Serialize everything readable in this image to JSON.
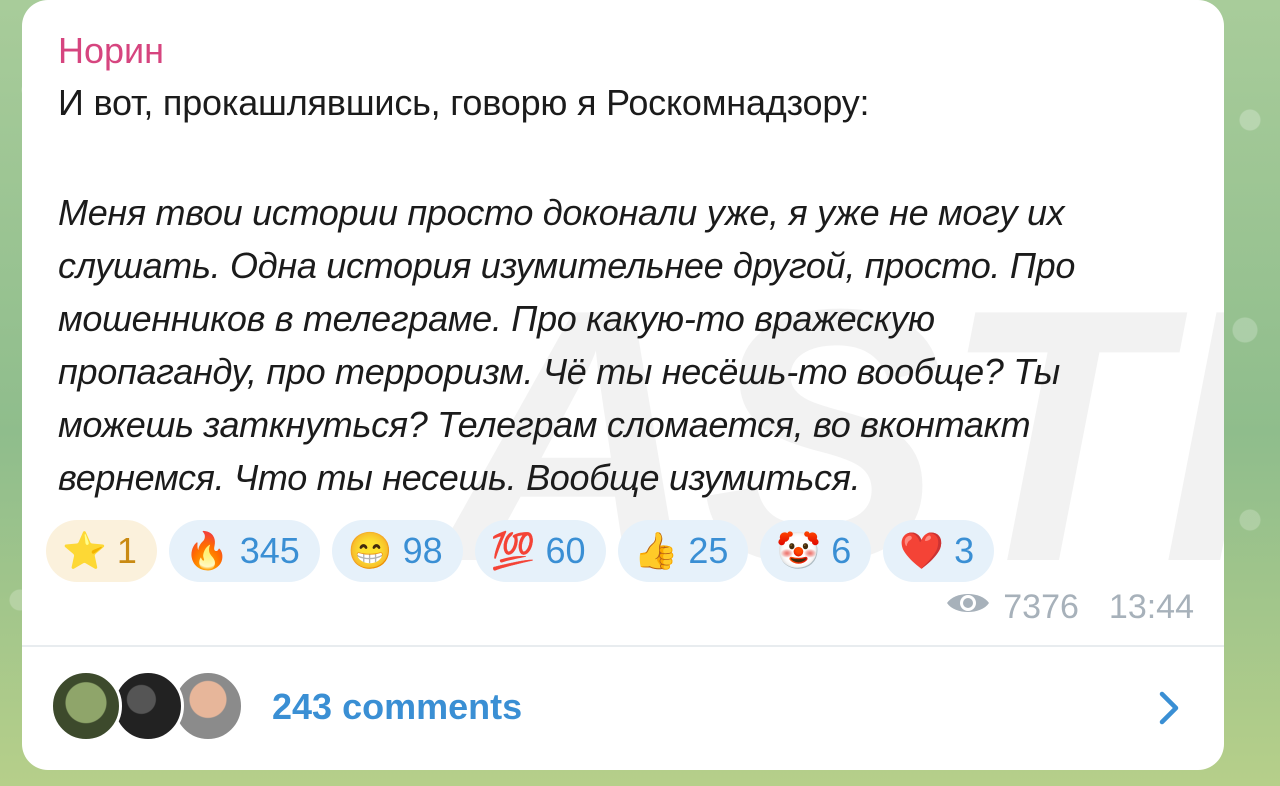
{
  "message": {
    "author": "Норин",
    "intro": "И вот, прокашлявшись, говорю я Роскомнадзору:",
    "quote_lines": [
      "Меня твои истории просто доконали уже, я уже не могу их",
      "слушать. Одна история изумительнее другой, просто. Про",
      "мошенников в телеграме. Про какую-то вражескую",
      "пропаганду, про терроризм. Чё ты несёшь-то вообще? Ты",
      "можешь заткнуться? Телеграм сломается, во вконтакт",
      "вернемся. Что ты несешь. Вообще изумиться."
    ],
    "watermark": "ASTRA"
  },
  "reactions": [
    {
      "emoji": "⭐",
      "count": "1",
      "icon": "star-icon"
    },
    {
      "emoji": "🔥",
      "count": "345",
      "icon": "fire-icon"
    },
    {
      "emoji": "😁",
      "count": "98",
      "icon": "grin-icon"
    },
    {
      "emoji": "💯",
      "count": "60",
      "icon": "hundred-icon"
    },
    {
      "emoji": "👍",
      "count": "25",
      "icon": "thumbs-up-icon"
    },
    {
      "emoji": "🤡",
      "count": "6",
      "icon": "clown-icon"
    },
    {
      "emoji": "❤️",
      "count": "3",
      "icon": "heart-icon"
    }
  ],
  "meta": {
    "views": "7376",
    "time": "13:44"
  },
  "footer": {
    "comments_label": "243 comments"
  },
  "colors": {
    "author": "#d6457f",
    "accent": "#3a8fd4"
  }
}
